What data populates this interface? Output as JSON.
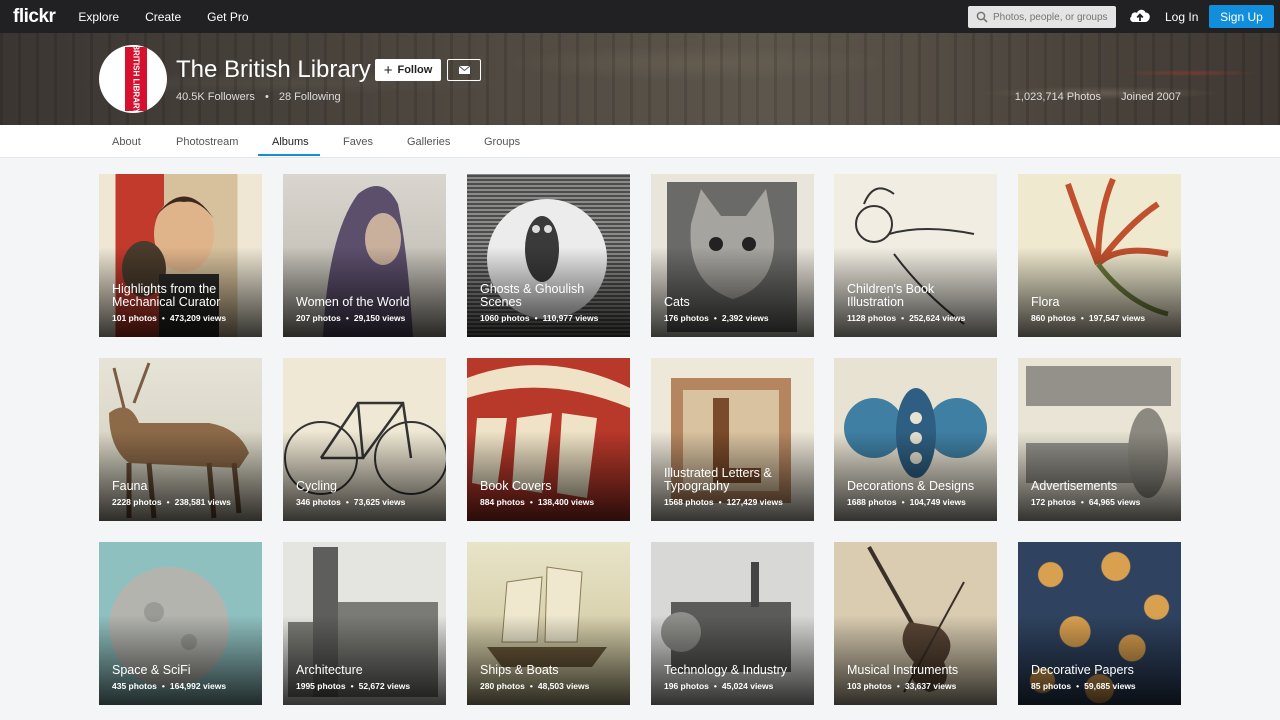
{
  "topbar": {
    "logo": "flickr",
    "nav": [
      "Explore",
      "Create",
      "Get Pro"
    ],
    "search_placeholder": "Photos, people, or groups",
    "login": "Log In",
    "signup": "Sign Up"
  },
  "profile": {
    "name": "The British Library",
    "logo_text": "BRITISH LIBRARY",
    "follow_label": "Follow",
    "followers": "40.5K Followers",
    "following": "28 Following",
    "photos": "1,023,714 Photos",
    "joined": "Joined 2007"
  },
  "tabs": [
    "About",
    "Photostream",
    "Albums",
    "Faves",
    "Galleries",
    "Groups"
  ],
  "active_tab": "Albums",
  "albums": [
    {
      "title": "Highlights from the Mechanical Curator",
      "photos": "101 photos",
      "views": "473,209 views"
    },
    {
      "title": "Women of the World",
      "photos": "207 photos",
      "views": "29,150 views"
    },
    {
      "title": "Ghosts & Ghoulish Scenes",
      "photos": "1060 photos",
      "views": "110,977 views"
    },
    {
      "title": "Cats",
      "photos": "176 photos",
      "views": "2,392 views"
    },
    {
      "title": "Children's Book Illustration",
      "photos": "1128 photos",
      "views": "252,624 views"
    },
    {
      "title": "Flora",
      "photos": "860 photos",
      "views": "197,547 views"
    },
    {
      "title": "Fauna",
      "photos": "2228 photos",
      "views": "238,581 views"
    },
    {
      "title": "Cycling",
      "photos": "346 photos",
      "views": "73,625 views"
    },
    {
      "title": "Book Covers",
      "photos": "884 photos",
      "views": "138,400 views"
    },
    {
      "title": "Illustrated Letters & Typography",
      "photos": "1568 photos",
      "views": "127,429 views"
    },
    {
      "title": "Decorations & Designs",
      "photos": "1688 photos",
      "views": "104,749 views"
    },
    {
      "title": "Advertisements",
      "photos": "172 photos",
      "views": "64,965 views"
    },
    {
      "title": "Space & SciFi",
      "photos": "435 photos",
      "views": "164,992 views"
    },
    {
      "title": "Architecture",
      "photos": "1995 photos",
      "views": "52,672 views"
    },
    {
      "title": "Ships & Boats",
      "photos": "280 photos",
      "views": "48,503 views"
    },
    {
      "title": "Technology & Industry",
      "photos": "196 photos",
      "views": "45,024 views"
    },
    {
      "title": "Musical Instruments",
      "photos": "103 photos",
      "views": "33,637 views"
    },
    {
      "title": "Decorative Papers",
      "photos": "85 photos",
      "views": "59,685 views"
    }
  ],
  "colors": {
    "accent": "#128fdc",
    "topbar": "#212124",
    "bl_red": "#d6102f"
  }
}
